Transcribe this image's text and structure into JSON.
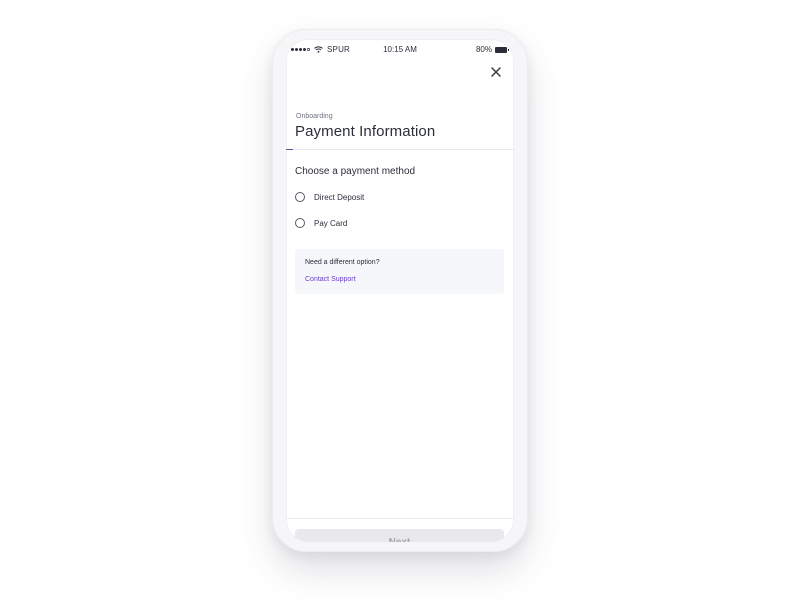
{
  "status_bar": {
    "carrier": "SPUR",
    "time": "10:15 AM",
    "battery": "80%",
    "icons": [
      "signal-icon",
      "wifi-icon",
      "battery-icon"
    ]
  },
  "header": {
    "close_icon": "close-icon",
    "overline": "Onboarding",
    "title": "Payment Information",
    "progress": 0.03
  },
  "form": {
    "question": "Choose a payment method",
    "options": [
      {
        "label": "Direct Deposit",
        "selected": false
      },
      {
        "label": "Pay Card",
        "selected": false
      }
    ]
  },
  "help_card": {
    "text": "Need a different option?",
    "link": "Contact Support"
  },
  "footer": {
    "next_label": "Next",
    "next_disabled": true
  },
  "colors": {
    "accent": "#6650a4",
    "link": "#6a3fc7",
    "text_primary": "#2c2e3b",
    "text_secondary": "#6f7282",
    "card_background": "#f6f7fb",
    "button_disabled_bg": "#e9e9ed",
    "button_disabled_text": "#a5a6ae"
  }
}
